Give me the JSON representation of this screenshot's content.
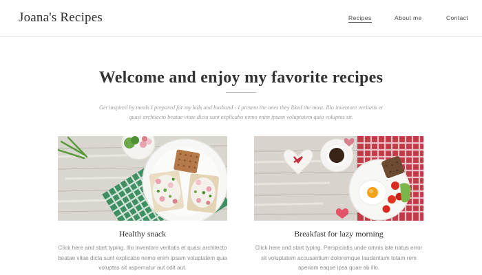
{
  "header": {
    "brand": "Joana's Recipes",
    "nav": [
      {
        "label": "Recipes",
        "active": true
      },
      {
        "label": "About me",
        "active": false
      },
      {
        "label": "Contact",
        "active": false
      }
    ]
  },
  "hero": {
    "title": "Welcome and enjoy my favorite recipes",
    "subtitle": "Get inspired by meals I prepared for my kids and husband - I present the ones they liked the most. Illo inventore veritatis et quasi architecto beatae vitae dicta sunt explicabo nemo enim ipsam voluptatem quia voluptas sit."
  },
  "cards": [
    {
      "title": "Healthy snack",
      "text": "Click here and start typing. Illo inventore veritatis et quasi architecto beatae vitae dicta sunt explicabo nemo enim ipsam voluptatem quia voluptas sit aspernatur aut odit aut.",
      "image": "healthy-snack-photo"
    },
    {
      "title": "Breakfast for lazy morning",
      "text": "Click here and start typing. Perspiciatis unde omnis iste natus error sit voluptatem accusantium doloremque laudantium totam rem aperiam eaque ipsa quae ab illo.",
      "image": "breakfast-photo"
    }
  ],
  "colors": {
    "text": "#333333",
    "muted": "#8c8c8c",
    "divider": "#e8e8e8"
  }
}
